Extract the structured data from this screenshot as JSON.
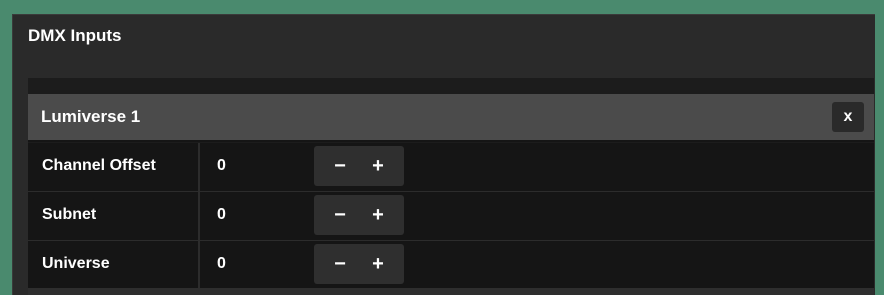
{
  "panel": {
    "title": "DMX Inputs"
  },
  "group": {
    "name": "Lumiverse 1",
    "close_label": "x"
  },
  "rows": [
    {
      "label": "Channel Offset",
      "value": "0",
      "minus": "−",
      "plus": "+"
    },
    {
      "label": "Subnet",
      "value": "0",
      "minus": "−",
      "plus": "+"
    },
    {
      "label": "Universe",
      "value": "0",
      "minus": "−",
      "plus": "+"
    }
  ],
  "colors": {
    "background": "#4a8a6e",
    "panel": "#2a2a2a",
    "header": "#4b4b4b",
    "row": "#151515",
    "button": "#2f2f2f"
  }
}
